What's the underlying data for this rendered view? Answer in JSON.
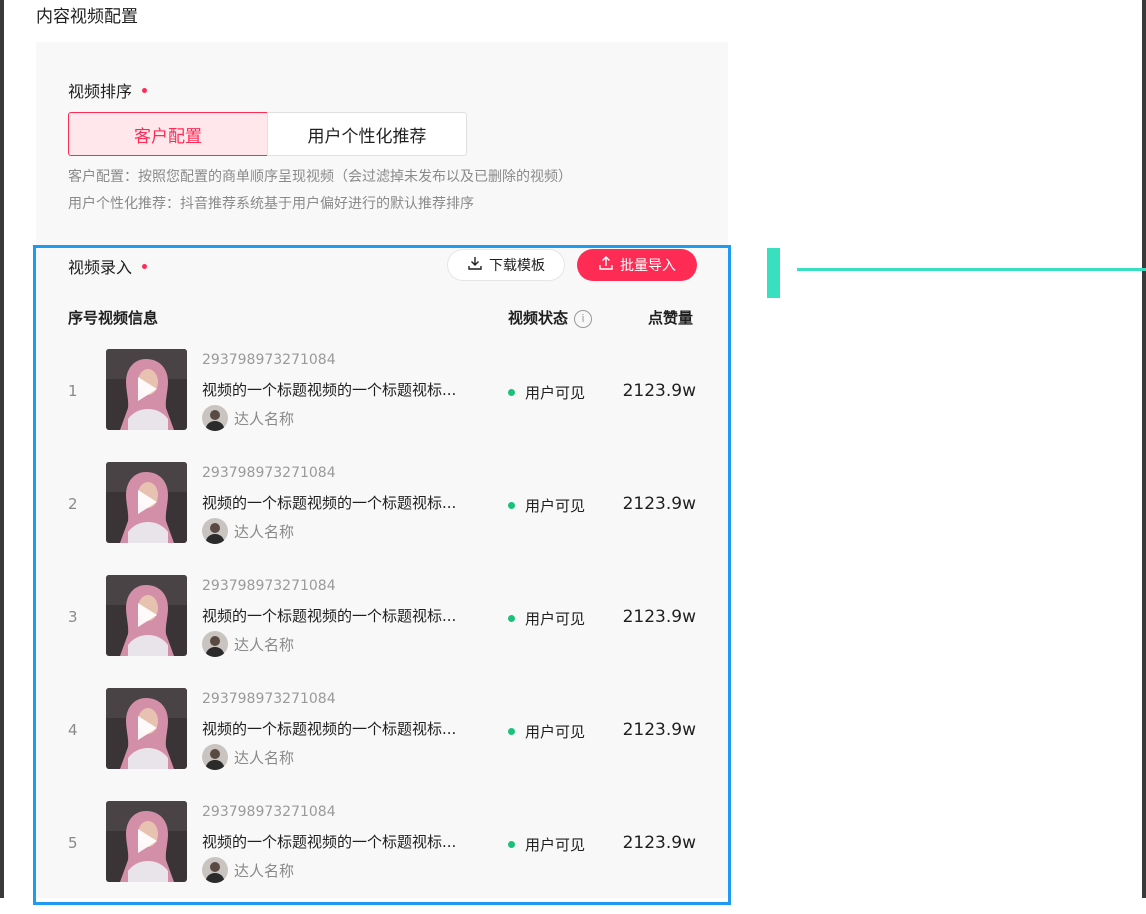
{
  "section_title": "内容视频配置",
  "sort": {
    "label": "视频排序",
    "options": [
      "客户配置",
      "用户个性化推荐"
    ],
    "selected": "客户配置",
    "hint_1": "客户配置：按照您配置的商单顺序呈现视频（会过滤掉未发布以及已删除的视频）",
    "hint_2": "用户个性化推荐：抖音推荐系统基于用户偏好进行的默认推荐排序"
  },
  "entry": {
    "label": "视频录入",
    "download_label": "下载模板",
    "import_label": "批量导入",
    "columns": {
      "index_info": "序号视频信息",
      "status": "视频状态",
      "likes": "点赞量"
    },
    "rows": [
      {
        "index": "1",
        "video_id": "293798973271084",
        "title": "视频的一个标题视频的一个标题视标...",
        "author": "达人名称",
        "status": "用户可见",
        "likes": "2123.9w"
      },
      {
        "index": "2",
        "video_id": "293798973271084",
        "title": "视频的一个标题视频的一个标题视标...",
        "author": "达人名称",
        "status": "用户可见",
        "likes": "2123.9w"
      },
      {
        "index": "3",
        "video_id": "293798973271084",
        "title": "视频的一个标题视频的一个标题视标...",
        "author": "达人名称",
        "status": "用户可见",
        "likes": "2123.9w"
      },
      {
        "index": "4",
        "video_id": "293798973271084",
        "title": "视频的一个标题视频的一个标题视标...",
        "author": "达人名称",
        "status": "用户可见",
        "likes": "2123.9w"
      },
      {
        "index": "5",
        "video_id": "293798973271084",
        "title": "视频的一个标题视频的一个标题视标...",
        "author": "达人名称",
        "status": "用户可见",
        "likes": "2123.9w"
      }
    ]
  },
  "colors": {
    "accent": "#fe2c55",
    "selection_border": "#1e9bf0",
    "marker": "#39e0bf",
    "status_visible": "#19c27a"
  },
  "icons": [
    "download-icon",
    "upload-icon",
    "info-icon",
    "play-icon",
    "required-dot-icon"
  ]
}
